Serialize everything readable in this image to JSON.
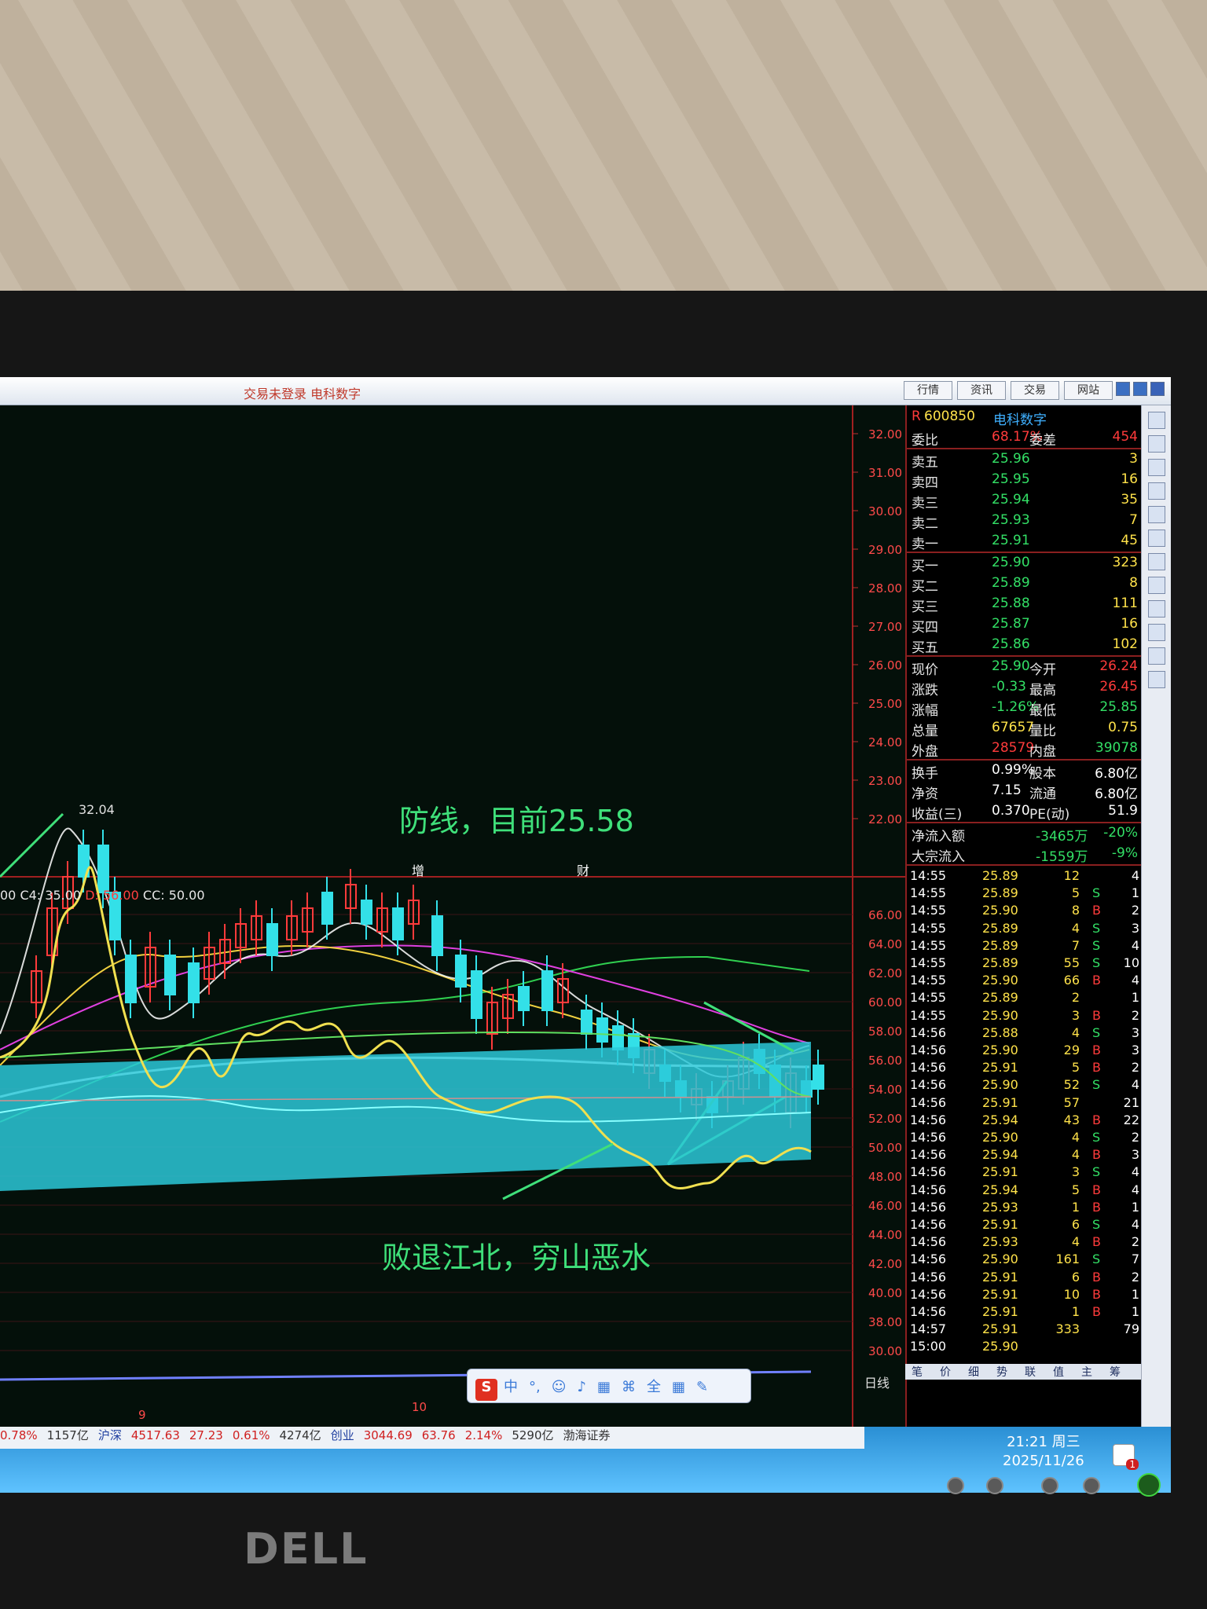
{
  "window": {
    "title": "交易未登录  电科数字",
    "nav_buttons": [
      "行情",
      "资讯",
      "交易",
      "网站"
    ]
  },
  "stock": {
    "code": "600850",
    "name": "电科数字",
    "tag": "R",
    "high_label": "32.04"
  },
  "price_axis": [
    "32.00",
    "31.00",
    "30.00",
    "29.00",
    "28.00",
    "27.00",
    "26.00",
    "25.00",
    "24.00",
    "23.00",
    "22.00"
  ],
  "indicator_axis": [
    "66.00",
    "64.00",
    "62.00",
    "60.00",
    "58.00",
    "56.00",
    "54.00",
    "52.00",
    "50.00",
    "48.00",
    "46.00",
    "44.00",
    "42.00",
    "40.00",
    "38.00",
    "30.00"
  ],
  "annotations": {
    "defense": "防线，目前25.58",
    "retreat": "败退江北，穷山恶水"
  },
  "markers": {
    "zeng": "增",
    "cai": "财"
  },
  "legend": {
    "prefix": "00",
    "c4": "C4: 35.00",
    "d": "D: 56.00",
    "cc": "CC: 50.00"
  },
  "period_label": "日线",
  "axis_bottom": [
    "9",
    "10"
  ],
  "quotes": {
    "weibi_label": "委比",
    "weibi_value": "68.17%",
    "weicha_label": "委差",
    "weicha_value": "454",
    "asks": [
      {
        "label": "卖五",
        "price": "25.96",
        "vol": "3"
      },
      {
        "label": "卖四",
        "price": "25.95",
        "vol": "16"
      },
      {
        "label": "卖三",
        "price": "25.94",
        "vol": "35"
      },
      {
        "label": "卖二",
        "price": "25.93",
        "vol": "7"
      },
      {
        "label": "卖一",
        "price": "25.91",
        "vol": "45"
      }
    ],
    "bids": [
      {
        "label": "买一",
        "price": "25.90",
        "vol": "323"
      },
      {
        "label": "买二",
        "price": "25.89",
        "vol": "8"
      },
      {
        "label": "买三",
        "price": "25.88",
        "vol": "111"
      },
      {
        "label": "买四",
        "price": "25.87",
        "vol": "16"
      },
      {
        "label": "买五",
        "price": "25.86",
        "vol": "102"
      }
    ],
    "stats": [
      {
        "l1": "现价",
        "v1": "25.90",
        "l2": "今开",
        "v2": "26.24"
      },
      {
        "l1": "涨跌",
        "v1": "-0.33",
        "l2": "最高",
        "v2": "26.45"
      },
      {
        "l1": "涨幅",
        "v1": "-1.26%",
        "l2": "最低",
        "v2": "25.85"
      },
      {
        "l1": "总量",
        "v1": "67657",
        "l2": "量比",
        "v2": "0.75"
      },
      {
        "l1": "外盘",
        "v1": "28579",
        "l2": "内盘",
        "v2": "39078"
      }
    ],
    "stats2": [
      {
        "l1": "换手",
        "v1": "0.99%",
        "l2": "股本",
        "v2": "6.80亿"
      },
      {
        "l1": "净资",
        "v1": "7.15",
        "l2": "流通",
        "v2": "6.80亿"
      },
      {
        "l1": "收益(三)",
        "v1": "0.370",
        "l2": "PE(动)",
        "v2": "51.9"
      }
    ],
    "flows": [
      {
        "l": "净流入额",
        "v": "-3465万",
        "p": "-20%"
      },
      {
        "l": "大宗流入",
        "v": "-1559万",
        "p": "-9%"
      }
    ]
  },
  "ticks": [
    {
      "t": "14:55",
      "p": "25.89",
      "v": "12",
      "f": "",
      "n": "4"
    },
    {
      "t": "14:55",
      "p": "25.89",
      "v": "5",
      "f": "S",
      "n": "1"
    },
    {
      "t": "14:55",
      "p": "25.90",
      "v": "8",
      "f": "B",
      "n": "2"
    },
    {
      "t": "14:55",
      "p": "25.89",
      "v": "4",
      "f": "S",
      "n": "3"
    },
    {
      "t": "14:55",
      "p": "25.89",
      "v": "7",
      "f": "S",
      "n": "4"
    },
    {
      "t": "14:55",
      "p": "25.89",
      "v": "55",
      "f": "S",
      "n": "10"
    },
    {
      "t": "14:55",
      "p": "25.90",
      "v": "66",
      "f": "B",
      "n": "4"
    },
    {
      "t": "14:55",
      "p": "25.89",
      "v": "2",
      "f": "",
      "n": "1"
    },
    {
      "t": "14:55",
      "p": "25.90",
      "v": "3",
      "f": "B",
      "n": "2"
    },
    {
      "t": "14:56",
      "p": "25.88",
      "v": "4",
      "f": "S",
      "n": "3"
    },
    {
      "t": "14:56",
      "p": "25.90",
      "v": "29",
      "f": "B",
      "n": "3"
    },
    {
      "t": "14:56",
      "p": "25.91",
      "v": "5",
      "f": "B",
      "n": "2"
    },
    {
      "t": "14:56",
      "p": "25.90",
      "v": "52",
      "f": "S",
      "n": "4"
    },
    {
      "t": "14:56",
      "p": "25.91",
      "v": "57",
      "f": "",
      "n": "21"
    },
    {
      "t": "14:56",
      "p": "25.94",
      "v": "43",
      "f": "B",
      "n": "22"
    },
    {
      "t": "14:56",
      "p": "25.90",
      "v": "4",
      "f": "S",
      "n": "2"
    },
    {
      "t": "14:56",
      "p": "25.94",
      "v": "4",
      "f": "B",
      "n": "3"
    },
    {
      "t": "14:56",
      "p": "25.91",
      "v": "3",
      "f": "S",
      "n": "4"
    },
    {
      "t": "14:56",
      "p": "25.94",
      "v": "5",
      "f": "B",
      "n": "4"
    },
    {
      "t": "14:56",
      "p": "25.93",
      "v": "1",
      "f": "B",
      "n": "1"
    },
    {
      "t": "14:56",
      "p": "25.91",
      "v": "6",
      "f": "S",
      "n": "4"
    },
    {
      "t": "14:56",
      "p": "25.93",
      "v": "4",
      "f": "B",
      "n": "2"
    },
    {
      "t": "14:56",
      "p": "25.90",
      "v": "161",
      "f": "S",
      "n": "7"
    },
    {
      "t": "14:56",
      "p": "25.91",
      "v": "6",
      "f": "B",
      "n": "2"
    },
    {
      "t": "14:56",
      "p": "25.91",
      "v": "10",
      "f": "B",
      "n": "1"
    },
    {
      "t": "14:56",
      "p": "25.91",
      "v": "1",
      "f": "B",
      "n": "1"
    },
    {
      "t": "14:57",
      "p": "25.91",
      "v": "333",
      "f": "",
      "n": "79"
    },
    {
      "t": "15:00",
      "p": "25.90",
      "v": "",
      "f": "",
      "n": ""
    }
  ],
  "info_tabs": [
    "笔",
    "价",
    "细",
    "势",
    "联",
    "值",
    "主",
    "筹"
  ],
  "ime": {
    "logo": "S",
    "items": [
      "中",
      "°,",
      "☺",
      "♪",
      "▦",
      "⌘",
      "全",
      "▦",
      "✎"
    ]
  },
  "index_bar": [
    {
      "text": "0.78%",
      "color": "#d02020"
    },
    {
      "text": "1157亿",
      "color": "#333"
    },
    {
      "text": "沪深",
      "color": "#2040a0"
    },
    {
      "text": "4517.63",
      "color": "#d02020"
    },
    {
      "text": "27.23",
      "color": "#d02020"
    },
    {
      "text": "0.61%",
      "color": "#d02020"
    },
    {
      "text": "4274亿",
      "color": "#333"
    },
    {
      "text": "创业",
      "color": "#2040a0"
    },
    {
      "text": "3044.69",
      "color": "#d02020"
    },
    {
      "text": "63.76",
      "color": "#d02020"
    },
    {
      "text": "2.14%",
      "color": "#d02020"
    },
    {
      "text": "5290亿",
      "color": "#333"
    },
    {
      "text": "渤海证券",
      "color": "#333"
    }
  ],
  "clock": {
    "time": "21:21 周三",
    "date": "2025/11/26"
  },
  "badge_count": "1",
  "brand": "DELL",
  "colors": {
    "up": "#ff3b3b",
    "down": "#33e0e8",
    "price": "#ffe24a",
    "ma_pink": "#e040e0",
    "ma_yellow": "#f0d040",
    "ma_green": "#30d050",
    "ma_white": "#ffffff",
    "band": "#2cc8d8",
    "annot": "#3fe07a"
  }
}
